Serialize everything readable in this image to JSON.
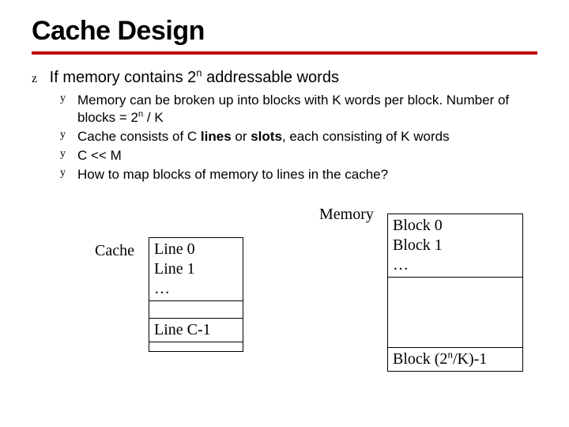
{
  "title": "Cache Design",
  "bullets": {
    "lvl1": {
      "marker": "z",
      "text_a": "If memory contains 2",
      "text_sup": "n",
      "text_b": " addressable words"
    },
    "lvl2": [
      {
        "marker": "y",
        "html": "Memory can be broken up into blocks with K words per block. Number of blocks = 2<sup>n</sup> / K"
      },
      {
        "marker": "y",
        "html": "Cache consists of C <b>lines</b> or <b>slots</b>, each consisting of K words"
      },
      {
        "marker": "y",
        "html": "C << M"
      },
      {
        "marker": "y",
        "html": "How to map blocks of memory to lines in the cache?"
      }
    ]
  },
  "diagram": {
    "memory_label": "Memory",
    "cache_label": "Cache",
    "cache_rows": {
      "r0": "Line 0",
      "r1": "Line 1",
      "r2": "…",
      "rlast": "Line C-1"
    },
    "memory_rows": {
      "r0": "Block 0",
      "r1": "Block 1",
      "r2": "…",
      "rlast_a": "Block (2",
      "rlast_sup": "n",
      "rlast_b": "/K)-1"
    }
  }
}
